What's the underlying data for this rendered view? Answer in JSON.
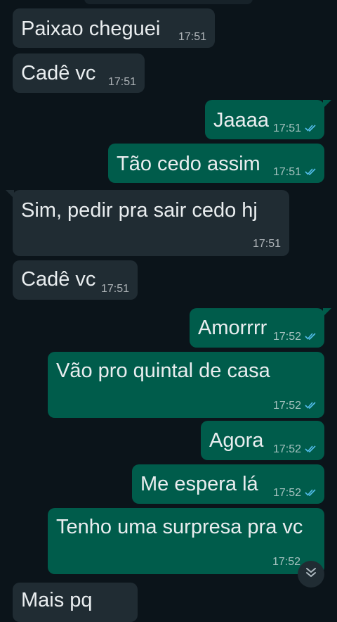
{
  "messages": [
    {
      "dir": "in",
      "text": "Paixao cheguei",
      "time": "17:51"
    },
    {
      "dir": "in",
      "text": "Cadê vc",
      "time": "17:51"
    },
    {
      "dir": "out",
      "text": "Jaaaa",
      "time": "17:51"
    },
    {
      "dir": "out",
      "text": "Tão cedo assim",
      "time": "17:51"
    },
    {
      "dir": "in",
      "text": "Sim, pedir pra sair cedo hj",
      "time": "17:51"
    },
    {
      "dir": "in",
      "text": "Cadê vc",
      "time": "17:51"
    },
    {
      "dir": "out",
      "text": "Amorrrr",
      "time": "17:52"
    },
    {
      "dir": "out",
      "text": "Vão pro quintal de casa",
      "time": "17:52"
    },
    {
      "dir": "out",
      "text": "Agora",
      "time": "17:52"
    },
    {
      "dir": "out",
      "text": "Me espera lá",
      "time": "17:52"
    },
    {
      "dir": "out",
      "text": "Tenho uma surpresa pra vc",
      "time": "17:52"
    },
    {
      "dir": "in",
      "text": "Mais pq",
      "time": ""
    }
  ],
  "colors": {
    "background": "#0b141a",
    "incoming_bubble": "#202c33",
    "outgoing_bubble": "#005c4b",
    "read_ticks": "#53bdeb"
  },
  "icons": {
    "read_receipt": "double-check-icon",
    "scroll_down": "chevron-double-down-icon"
  }
}
